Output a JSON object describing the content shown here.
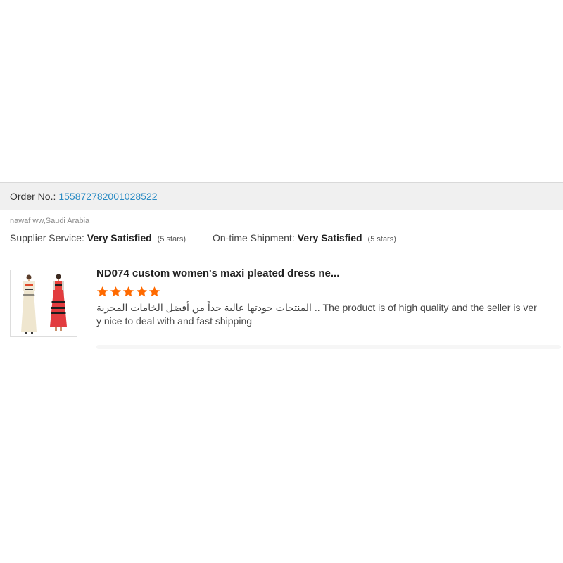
{
  "order": {
    "label": "Order No.:",
    "number": "155872782001028522"
  },
  "buyer": {
    "name_country": "nawaf ww,Saudi Arabia"
  },
  "ratings": {
    "supplier_label": "Supplier Service:",
    "supplier_value": "Very Satisfied",
    "supplier_stars": "(5 stars)",
    "shipment_label": "On-time Shipment:",
    "shipment_value": "Very Satisfied",
    "shipment_stars": "(5 stars)"
  },
  "review": {
    "product_title": "ND074 custom women's maxi pleated dress ne...",
    "star_count": 5,
    "star_color": "#ff6a00",
    "text": "المنتجات جودتها عالية جداً من أفضل الخامات المجربة .. The product is of high quality and the seller is very nice to deal with and fast shipping"
  },
  "colors": {
    "link": "#2a8bc4",
    "header_bg": "#f0f0f0"
  },
  "icons": {
    "rating": "star-icon",
    "thumbnail": "dress-product-image"
  }
}
